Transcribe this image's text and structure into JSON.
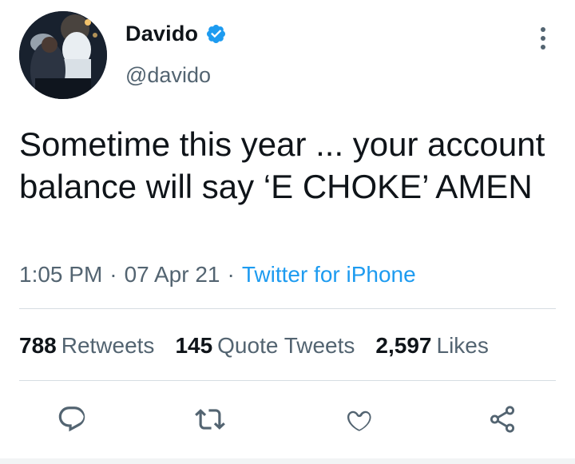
{
  "user": {
    "display_name": "Davido",
    "handle": "@davido",
    "verified": true
  },
  "tweet": {
    "text": "Sometime this year ... your account balance will say ‘E CHOKE’ AMEN",
    "time": "1:05 PM",
    "date": "07 Apr 21",
    "separator": "·",
    "source": "Twitter for iPhone"
  },
  "stats": {
    "retweets_count": "788",
    "retweets_label": "Retweets",
    "quotes_count": "145",
    "quotes_label": "Quote Tweets",
    "likes_count": "2,597",
    "likes_label": "Likes"
  },
  "colors": {
    "text": "#0f1419",
    "muted": "#536471",
    "accent": "#1d9bf0",
    "divider": "#d6dde2"
  },
  "icons": [
    "verified-badge-icon",
    "more-options-icon",
    "reply-icon",
    "retweet-icon",
    "like-icon",
    "share-icon"
  ]
}
